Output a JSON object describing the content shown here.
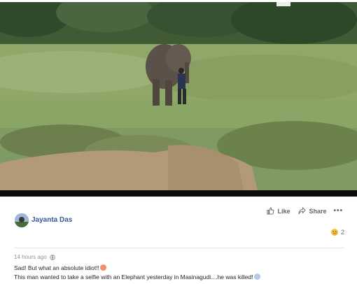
{
  "post": {
    "author": "Jayanta Das",
    "like_label": "Like",
    "share_label": "Share",
    "more_label": "•••",
    "reaction_count": "2",
    "timestamp": "14 hours ago",
    "text_line1": "Sad! But what an absolute idiot!!",
    "text_line2": "This man wanted to take a selfie with an Elephant yesterday in Masinagudi....he was killed!"
  },
  "icons": {
    "like": "thumbs-up-icon",
    "share": "share-arrow-icon",
    "more": "more-options-icon",
    "reaction": "sad-face-icon",
    "privacy": "globe-icon"
  },
  "colors": {
    "author_link": "#385898",
    "muted_text": "#606770",
    "body_text": "#1d2129",
    "divider": "#e5e5e5"
  }
}
